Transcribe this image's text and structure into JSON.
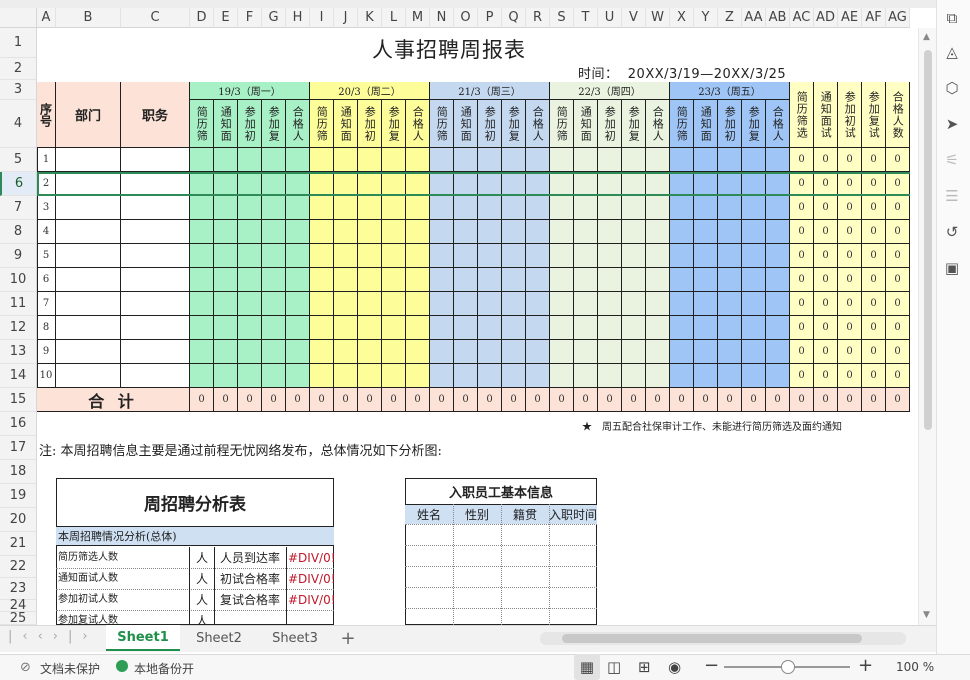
{
  "sheet": {
    "columns": [
      "A",
      "B",
      "C",
      "D",
      "E",
      "F",
      "G",
      "H",
      "I",
      "J",
      "K",
      "L",
      "M",
      "N",
      "O",
      "P",
      "Q",
      "R",
      "S",
      "T",
      "U",
      "V",
      "W",
      "X",
      "Y",
      "Z",
      "AA",
      "AB",
      "AC",
      "AD",
      "AE",
      "AF",
      "AG"
    ],
    "rows": [
      "1",
      "2",
      "3",
      "4",
      "5",
      "6",
      "7",
      "8",
      "9",
      "10",
      "11",
      "12",
      "13",
      "14",
      "15",
      "16",
      "17",
      "18",
      "19",
      "20",
      "21",
      "22",
      "23",
      "24",
      "25"
    ],
    "selected_row": "6"
  },
  "report": {
    "title": "人事招聘周报表",
    "time_label": "时间：",
    "time_value": "20XX/3/19—20XX/3/25",
    "seq_header": "序号",
    "dept_header": "部门",
    "job_header": "职务",
    "days": [
      {
        "label": "19/3（周一）",
        "color": "#a8f0c6"
      },
      {
        "label": "20/3（周二）",
        "color": "#fdfd9a"
      },
      {
        "label": "21/3（周三）",
        "color": "#c4d8ef"
      },
      {
        "label": "22/3（周四）",
        "color": "#e9f3e0"
      },
      {
        "label": "23/3（周五）",
        "color": "#9fc5f7"
      }
    ],
    "day_subheaders": [
      "简历筛",
      "通知面",
      "参加初",
      "参加复",
      "合格人"
    ],
    "total_subheaders": [
      "简历筛选",
      "通知面试",
      "参加初试",
      "参加复试",
      "合格人数"
    ],
    "total_color": "#ffffc4",
    "total_row_color": "#fde3d7",
    "row_numbers": [
      "1",
      "2",
      "3",
      "4",
      "5",
      "6",
      "7",
      "8",
      "9",
      "10"
    ],
    "zero": "0",
    "total_label": "合 计",
    "star_note": "★　周五配合社保审计工作、未能进行简历筛选及面约通知",
    "note": "注: 本周招聘信息主要是通过前程无忧网络发布，总体情况如下分析图:"
  },
  "analysis": {
    "title": "周招聘分析表",
    "section": "本周招聘情况分析(总体)",
    "rows": [
      {
        "label": "简历筛选人数",
        "unit": "人",
        "metric": "人员到达率",
        "value": "#DIV/0!"
      },
      {
        "label": "通知面试人数",
        "unit": "人",
        "metric": "初试合格率",
        "value": "#DIV/0!"
      },
      {
        "label": "参加初试人数",
        "unit": "人",
        "metric": "复试合格率",
        "value": "#DIV/0!"
      },
      {
        "label": "参加复试人数",
        "unit": "人",
        "metric": "",
        "value": ""
      }
    ]
  },
  "employees": {
    "title": "入职员工基本信息",
    "headers": [
      "姓名",
      "性别",
      "籍贯",
      "入职时间"
    ]
  },
  "tabs": [
    "Sheet1",
    "Sheet2",
    "Sheet3"
  ],
  "status": {
    "protect": "文档未保护",
    "backup": "本地备份开",
    "zoom": "100 %"
  }
}
